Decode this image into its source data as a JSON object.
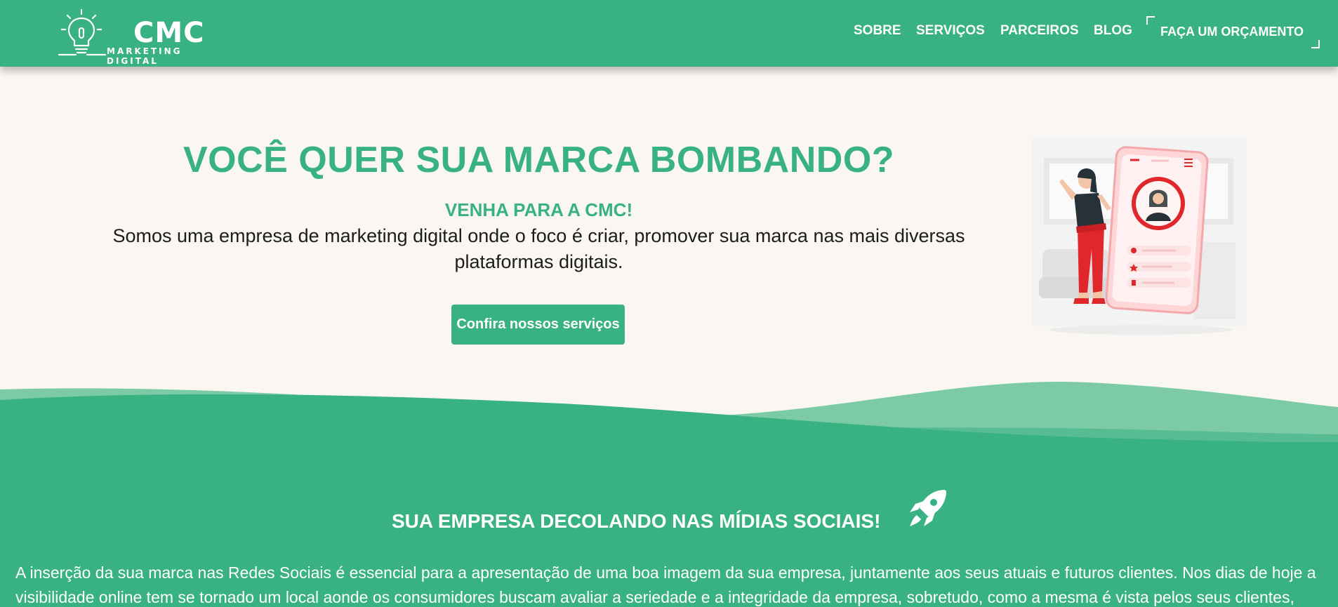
{
  "brand": {
    "name": "CMC",
    "tagline": "MARKETING DIGITAL"
  },
  "nav": {
    "items": [
      "SOBRE",
      "SERVIÇOS",
      "PARCEIROS",
      "BLOG"
    ],
    "cta": "FAÇA UM ORÇAMENTO"
  },
  "hero": {
    "title": "VOCÊ QUER SUA MARCA BOMBANDO?",
    "subtitle": "VENHA PARA A CMC!",
    "description": "Somos uma empresa de marketing digital onde o foco é criar, promover sua marca nas mais diversas plataformas digitais.",
    "button": "Confira nossos serviços"
  },
  "section": {
    "title": "SUA EMPRESA DECOLANDO NAS MÍDIAS SOCIAIS!",
    "icon": "rocket-icon",
    "text": "A inserção da sua marca nas Redes Sociais é essencial para a apresentação de uma boa imagem da sua empresa, juntamente aos seus atuais e futuros clientes. Nos dias de hoje a visibilidade online tem se tornado um local aonde os consumidores buscam avaliar a seriedade e a integridade da empresa, sobretudo, como a mesma é vista pelos seus clientes,"
  },
  "colors": {
    "primary": "#38b183",
    "background": "#faf7f2",
    "accent_red": "#e0282c"
  }
}
